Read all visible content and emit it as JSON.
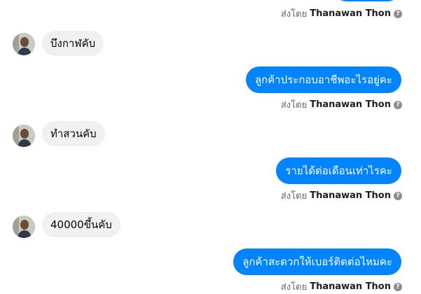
{
  "sender_prefix": "ส่งโดย",
  "sender_name": "Thanawan Thon",
  "help_glyph": "?",
  "colors": {
    "outgoing_bubble": "#0084ff",
    "incoming_bubble": "#f0f0f0",
    "meta_text": "#65676b"
  },
  "messages": [
    {
      "direction": "incoming",
      "text": "บึงกาฬคับ"
    },
    {
      "direction": "outgoing",
      "text": "ลูกค้าประกอบอาชีพอะไรอยู่คะ"
    },
    {
      "direction": "incoming",
      "text": "ทำสวนคับ"
    },
    {
      "direction": "outgoing",
      "text": "รายได้ต่อเดือนเท่าไรคะ"
    },
    {
      "direction": "incoming",
      "text": "40000ขึ้นคับ"
    },
    {
      "direction": "outgoing",
      "text": "ลูกค้าสะดวกให้เบอร์ติดต่อไหมคะ"
    }
  ]
}
